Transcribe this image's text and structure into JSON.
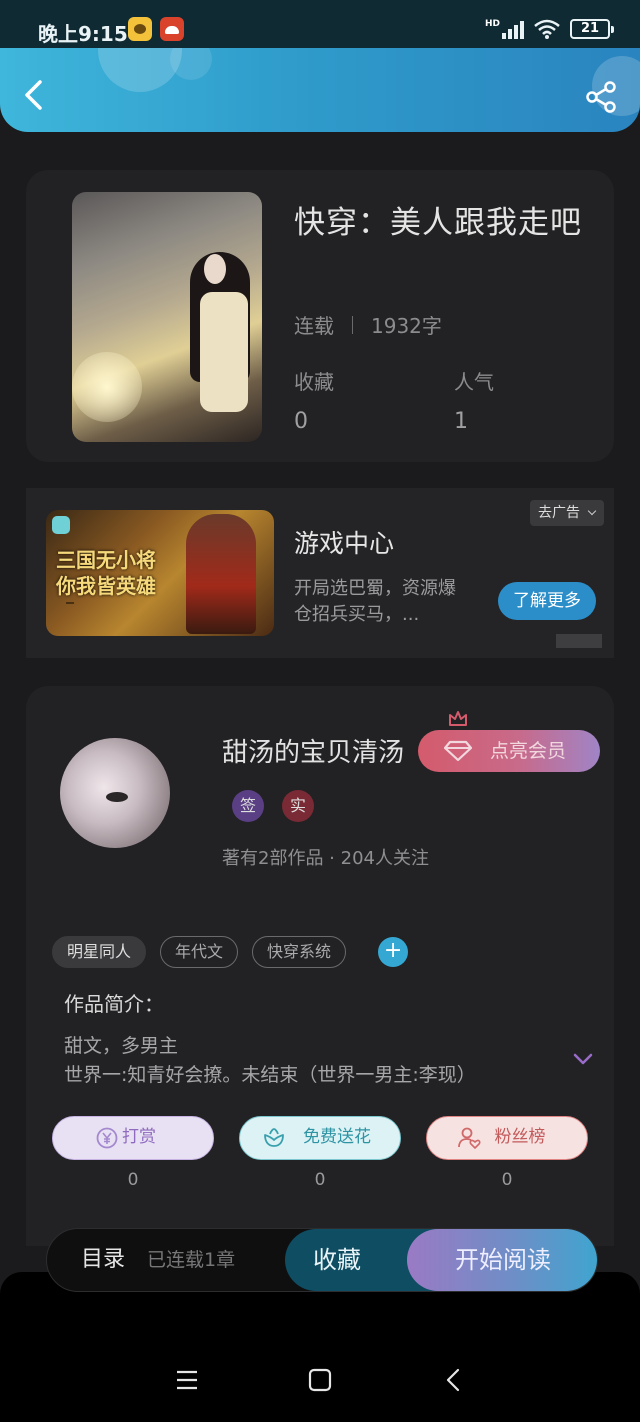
{
  "status_bar": {
    "time": "晚上9:15",
    "network": "HD",
    "battery": "21"
  },
  "book": {
    "title": "快穿：美人跟我走吧",
    "status": "连载",
    "word_count": "1932字",
    "stats": [
      {
        "label": "收藏",
        "value": "0"
      },
      {
        "label": "人气",
        "value": "1"
      }
    ]
  },
  "ad": {
    "title": "游戏中心",
    "description": "开局选巴蜀，资源爆仓招兵买马，...",
    "remove_label": "去广告",
    "more_label": "了解更多",
    "image_text_1": "三国无小将",
    "image_text_2": "你我皆英雄"
  },
  "author": {
    "name": "甜汤的宝贝清汤",
    "vip_label": "点亮会员",
    "badges": [
      "签",
      "实"
    ],
    "info": "著有2部作品 · 204人关注"
  },
  "tags": [
    "明星同人",
    "年代文",
    "快穿系统"
  ],
  "intro": {
    "heading": "作品简介：",
    "line1": "甜文，多男主",
    "line2": "世界一:知青好会撩。未结束（世界一男主:李现）"
  },
  "actions": [
    {
      "label": "打赏",
      "count": "0"
    },
    {
      "label": "免费送花",
      "count": "0"
    },
    {
      "label": "粉丝榜",
      "count": "0"
    }
  ],
  "bottom_bar": {
    "toc_label": "目录",
    "chapter_count": "已连载1章",
    "favorite_label": "收藏",
    "read_label": "开始阅读"
  },
  "colors": {
    "header_gradient_start": "#3fb6db",
    "header_gradient_end": "#2a84bf",
    "background": "#1b1b1d",
    "card": "#222224",
    "accent_blue": "#2c8ec9",
    "vip_pink": "#d45b6c"
  }
}
